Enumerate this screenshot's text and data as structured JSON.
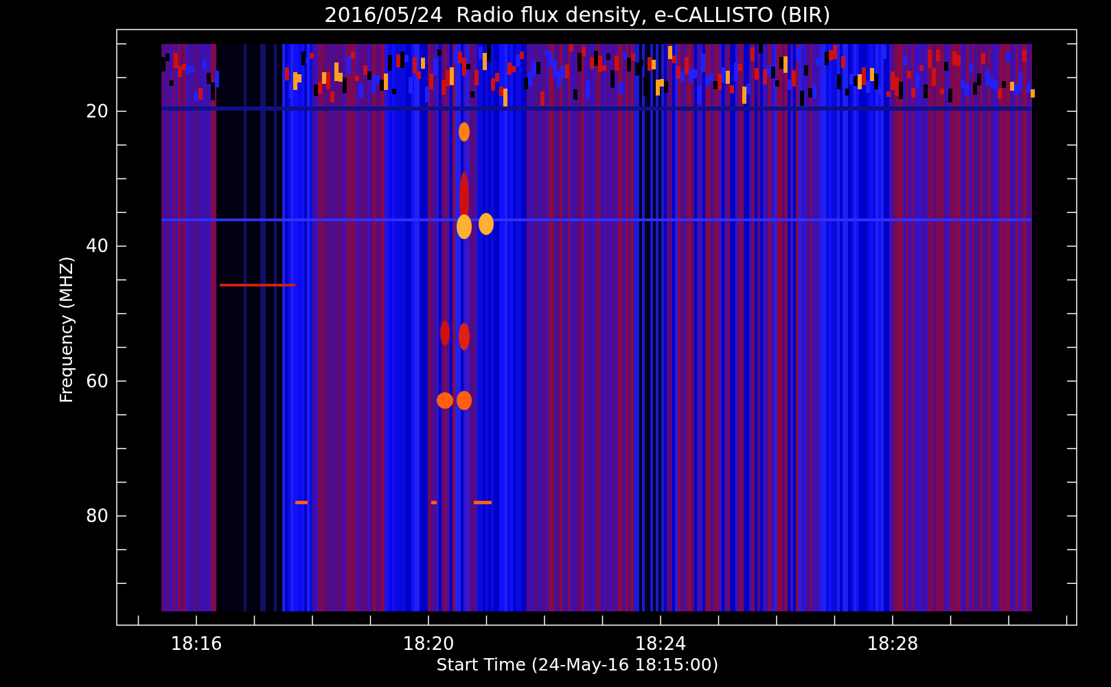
{
  "chart": {
    "title": "2016/05/24  Radio flux density, e-CALLISTO (BIR)",
    "xlabel": "Start Time (24-May-16 18:15:00)",
    "ylabel": "Frequency (MHZ)",
    "yticks": [
      "20",
      "40",
      "60",
      "80"
    ],
    "xticks": [
      "18:16",
      "18:20",
      "18:24",
      "18:28"
    ]
  }
}
